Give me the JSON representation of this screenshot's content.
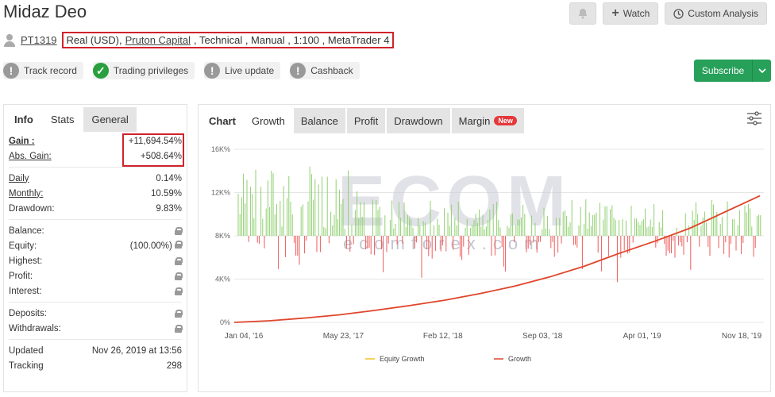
{
  "header": {
    "title": "Midaz Deo",
    "watch_label": "Watch",
    "custom_analysis_label": "Custom Analysis"
  },
  "meta": {
    "user_id": "PT1319",
    "account_type": "Real (USD),",
    "broker": "Pruton Capital",
    "details": ", Technical , Manual , 1:100 , MetaTrader 4"
  },
  "badges": [
    {
      "label": "Track record",
      "icon": "exclamation-icon",
      "ok": false
    },
    {
      "label": "Trading privileges",
      "icon": "check-icon",
      "ok": true
    },
    {
      "label": "Live update",
      "icon": "exclamation-icon",
      "ok": false
    },
    {
      "label": "Cashback",
      "icon": "exclamation-icon",
      "ok": false
    }
  ],
  "subscribe_label": "Subscribe",
  "left_tabs": {
    "info": "Info",
    "stats": "Stats",
    "general": "General"
  },
  "stats": {
    "gain": {
      "label": "Gain :",
      "value": "+11,694.54%"
    },
    "abs_gain": {
      "label": "Abs. Gain:",
      "value": "+508.64%"
    },
    "daily": {
      "label": "Daily",
      "value": "0.14%"
    },
    "monthly": {
      "label": "Monthly:",
      "value": "10.59%"
    },
    "drawdown": {
      "label": "Drawdown:",
      "value": "9.83%"
    },
    "balance": {
      "label": "Balance:"
    },
    "equity": {
      "label": "Equity:",
      "value": "(100.00%)"
    },
    "highest": {
      "label": "Highest:"
    },
    "profit": {
      "label": "Profit:"
    },
    "interest": {
      "label": "Interest:"
    },
    "deposits": {
      "label": "Deposits:"
    },
    "withdrawals": {
      "label": "Withdrawals:"
    },
    "updated": {
      "label": "Updated",
      "value": "Nov 26, 2019 at 13:56"
    },
    "tracking": {
      "label": "Tracking",
      "value": "298"
    }
  },
  "chart_tabs": {
    "chart": "Chart",
    "growth": "Growth",
    "balance": "Balance",
    "profit": "Profit",
    "drawdown": "Drawdown",
    "margin": "Margin",
    "new_badge": "New"
  },
  "watermark": {
    "brand": "ECOM",
    "site": "ecomforex.com"
  },
  "colors": {
    "growth": "#e0452b",
    "equity": "#f3c325",
    "bar_up": "#8fd06f",
    "bar_down": "#ee5b5b",
    "subscribe": "#27a05a"
  },
  "chart_data": {
    "type": "line",
    "y_ticks": [
      "0%",
      "4K%",
      "8K%",
      "12K%",
      "16K%"
    ],
    "ylim": [
      0,
      16000
    ],
    "x_ticks": [
      "Jan 04, '16",
      "May 23, '17",
      "Feb 12, '18",
      "Sep 03, '18",
      "Apr 01, '19",
      "Nov 18, '19"
    ],
    "series": [
      {
        "name": "Equity Growth",
        "values": []
      },
      {
        "name": "Growth",
        "values": [
          0,
          150,
          400,
          700,
          1100,
          1550,
          2050,
          2650,
          3350,
          4200,
          5200,
          6400,
          7500,
          8700,
          10200,
          11700
        ]
      }
    ],
    "secondary_bars": "daily gain bars (green up / red down) around 8K% line",
    "legend": "bottom"
  }
}
